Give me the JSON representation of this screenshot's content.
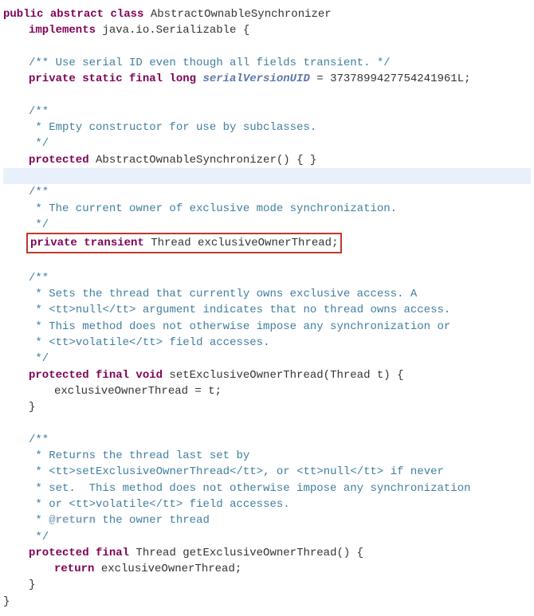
{
  "l1": {
    "kw1": "public",
    "kw2": "abstract",
    "kw3": "class",
    "name": " AbstractOwnableSynchronizer"
  },
  "l2": {
    "kw": "implements",
    "pkg": " java.io.Serializable {"
  },
  "l3": "",
  "l4": {
    "c": "/** Use serial ID even though all fields transient. */"
  },
  "l5": {
    "kw": "private static final long ",
    "id": "serialVersionUID",
    "rest": " = 3737899427754241961L;"
  },
  "l6": "",
  "l7": {
    "c": "/**"
  },
  "l8": {
    "c": " * Empty constructor for use by subclasses."
  },
  "l9": {
    "c": " */"
  },
  "l10": {
    "kw": "protected",
    "rest": " AbstractOwnableSynchronizer() { }"
  },
  "l11": "",
  "l12": {
    "c": "/**"
  },
  "l13": {
    "c": " * The current owner of exclusive mode synchronization."
  },
  "l14": {
    "c": " */"
  },
  "l15": {
    "kw": "private transient",
    "rest": " Thread exclusiveOwnerThread;"
  },
  "l16": "",
  "l17": {
    "c": "/**"
  },
  "l18a": " * Sets the thread that currently owns exclusive access. A",
  "l18b1": " * ",
  "l18b2": "<tt>",
  "l18b3": "null",
  "l18b4": "</tt>",
  "l18b5": " argument indicates that no thread owns access.",
  "l18c": " * This method does not otherwise impose any synchronization or",
  "l18d1": " * ",
  "l18d2": "<tt>",
  "l18d3": "volatile",
  "l18d4": "</tt>",
  "l18d5": " field accesses.",
  "l19": {
    "c": " */"
  },
  "l20": {
    "kw1": "protected final void",
    "rest": " setExclusiveOwnerThread(Thread t) {"
  },
  "l21": "exclusiveOwnerThread = t;",
  "l22": "}",
  "l23": "",
  "l24": {
    "c": "/**"
  },
  "l25a": " * Returns the thread last set by",
  "l25b1": " * ",
  "l25b2": "<tt>",
  "l25b3": "setExclusiveOwnerThread",
  "l25b4": "</tt>",
  "l25b5": ", or ",
  "l25b6": "<tt>",
  "l25b7": "null",
  "l25b8": "</tt>",
  "l25b9": " if never",
  "l25c": " * set.  This method does not otherwise impose any synchronization",
  "l25d1": " * or ",
  "l25d2": "<tt>",
  "l25d3": "volatile",
  "l25d4": "</tt>",
  "l25d5": " field accesses.",
  "l25e1": " * ",
  "l25e2": "@return",
  "l25e3": " the owner thread",
  "l26": {
    "c": " */"
  },
  "l27": {
    "kw1": "protected final",
    "rest": " Thread getExclusiveOwnerThread() {"
  },
  "l28": {
    "kw": "return",
    "rest": " exclusiveOwnerThread;"
  },
  "l29": "}",
  "l30": "}"
}
